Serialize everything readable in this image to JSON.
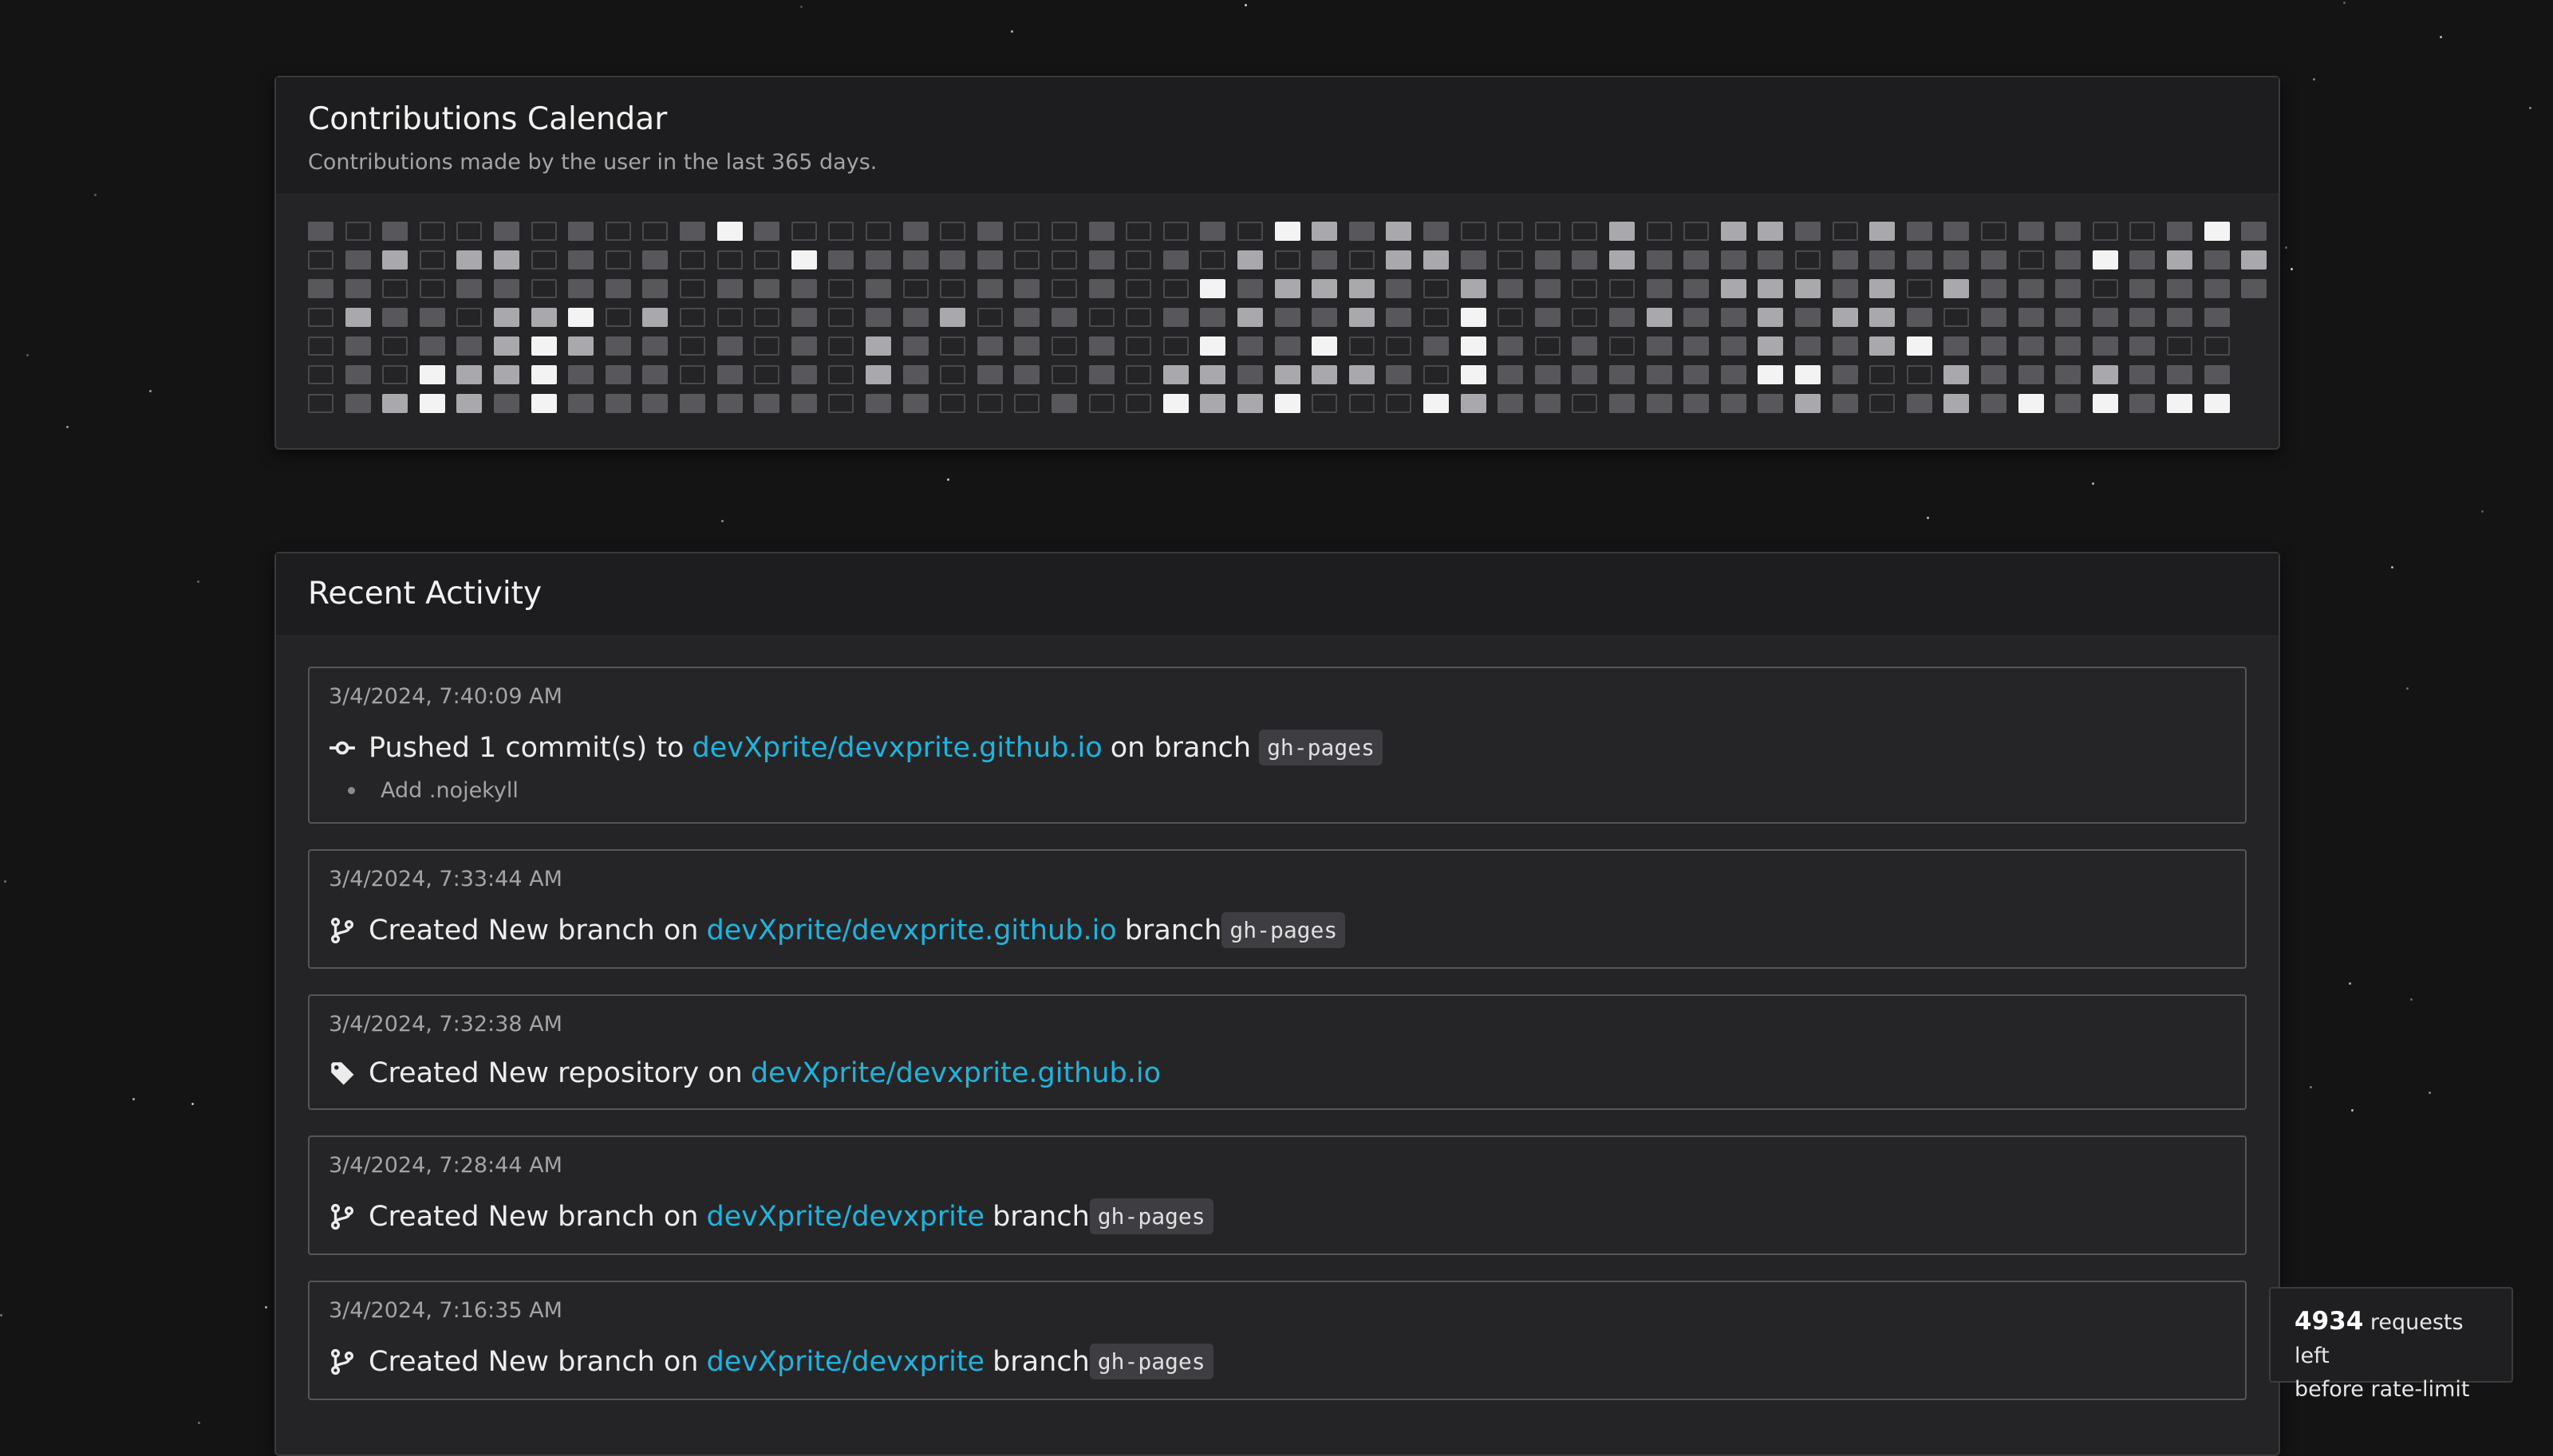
{
  "contributions": {
    "title": "Contributions Calendar",
    "subtitle": "Contributions made by the user in the last 365 days.",
    "weeks": 53,
    "days_last_week": 3,
    "level_colors": [
      "#4a4a4e",
      "#58585c",
      "#a9a9ad",
      "#f3f3f3"
    ],
    "grid": [
      [
        1,
        0,
        1,
        0,
        0,
        1,
        0,
        1,
        0,
        0,
        1,
        3,
        1,
        0,
        0,
        0,
        1,
        0,
        1,
        0,
        0,
        1,
        0,
        0,
        1,
        0,
        3,
        2,
        1,
        2,
        1,
        0,
        0,
        0,
        0,
        2,
        0,
        0,
        2,
        2,
        1,
        0,
        2,
        1,
        1,
        0,
        1,
        1,
        0,
        0,
        1,
        3,
        1
      ],
      [
        0,
        1,
        2,
        0,
        2,
        2,
        0,
        1,
        0,
        1,
        0,
        0,
        0,
        3,
        1,
        1,
        1,
        1,
        1,
        0,
        0,
        1,
        0,
        1,
        0,
        2,
        0,
        1,
        0,
        2,
        2,
        1,
        0,
        1,
        1,
        2,
        1,
        1,
        1,
        1,
        0,
        1,
        1,
        1,
        1,
        1,
        0,
        1,
        3,
        1,
        2,
        1,
        2
      ],
      [
        1,
        1,
        0,
        0,
        1,
        1,
        0,
        1,
        1,
        1,
        0,
        1,
        1,
        1,
        0,
        1,
        0,
        0,
        1,
        1,
        0,
        1,
        0,
        0,
        3,
        1,
        2,
        2,
        2,
        1,
        0,
        2,
        1,
        1,
        0,
        0,
        1,
        1,
        2,
        2,
        2,
        1,
        2,
        0,
        2,
        1,
        1,
        1,
        0,
        1,
        1,
        1,
        1
      ],
      [
        0,
        2,
        1,
        1,
        0,
        2,
        2,
        3,
        0,
        2,
        0,
        0,
        0,
        1,
        0,
        1,
        1,
        2,
        0,
        1,
        1,
        0,
        0,
        1,
        1,
        2,
        1,
        1,
        2,
        1,
        0,
        3,
        0,
        1,
        0,
        1,
        2,
        1,
        1,
        2,
        1,
        2,
        2,
        1,
        0,
        1,
        1,
        1,
        1,
        1,
        1,
        1
      ],
      [
        0,
        1,
        0,
        1,
        1,
        2,
        3,
        2,
        1,
        1,
        0,
        1,
        0,
        1,
        0,
        2,
        1,
        0,
        1,
        1,
        0,
        1,
        0,
        0,
        3,
        1,
        1,
        3,
        0,
        0,
        1,
        3,
        1,
        0,
        1,
        0,
        1,
        1,
        1,
        2,
        1,
        1,
        2,
        3,
        1,
        1,
        1,
        1,
        1,
        1,
        0,
        0
      ],
      [
        0,
        1,
        0,
        3,
        2,
        2,
        3,
        1,
        1,
        1,
        0,
        1,
        0,
        1,
        0,
        2,
        1,
        0,
        1,
        1,
        0,
        1,
        0,
        2,
        2,
        1,
        2,
        2,
        2,
        1,
        0,
        3,
        1,
        1,
        1,
        1,
        1,
        1,
        1,
        3,
        3,
        1,
        0,
        0,
        2,
        1,
        1,
        1,
        2,
        1,
        1,
        1
      ],
      [
        0,
        1,
        2,
        3,
        2,
        1,
        3,
        1,
        1,
        1,
        1,
        1,
        1,
        1,
        0,
        1,
        1,
        0,
        0,
        0,
        1,
        0,
        0,
        3,
        2,
        2,
        3,
        0,
        0,
        0,
        3,
        2,
        1,
        1,
        0,
        1,
        1,
        1,
        1,
        1,
        2,
        1,
        0,
        1,
        2,
        1,
        3,
        1,
        3,
        1,
        3,
        3
      ]
    ]
  },
  "activity": {
    "title": "Recent Activity",
    "events": [
      {
        "time": "3/4/2024, 7:40:09 AM",
        "icon": "commit-icon",
        "action": "Pushed 1 commit(s) to",
        "repo": "devXprite/devxprite.github.io",
        "middle": "on branch",
        "branch": "gh-pages",
        "commits": [
          "Add .nojekyll"
        ]
      },
      {
        "time": "3/4/2024, 7:33:44 AM",
        "icon": "git-branch-icon",
        "action": "Created New branch on",
        "repo": "devXprite/devxprite.github.io",
        "middle": "branch",
        "branch": "gh-pages"
      },
      {
        "time": "3/4/2024, 7:32:38 AM",
        "icon": "tag-icon",
        "action": "Created New repository on",
        "repo": "devXprite/devxprite.github.io"
      },
      {
        "time": "3/4/2024, 7:28:44 AM",
        "icon": "git-branch-icon",
        "action": "Created New branch on",
        "repo": "devXprite/devxprite",
        "middle": "branch",
        "branch": "gh-pages"
      },
      {
        "time": "3/4/2024, 7:16:35 AM",
        "icon": "git-branch-icon",
        "action": "Created New branch on",
        "repo": "devXprite/devxprite",
        "middle": "branch",
        "branch": "gh-pages"
      }
    ]
  },
  "rate_limit": {
    "count": "4934",
    "text_1": "requests left",
    "text_2": "before rate-limit"
  }
}
